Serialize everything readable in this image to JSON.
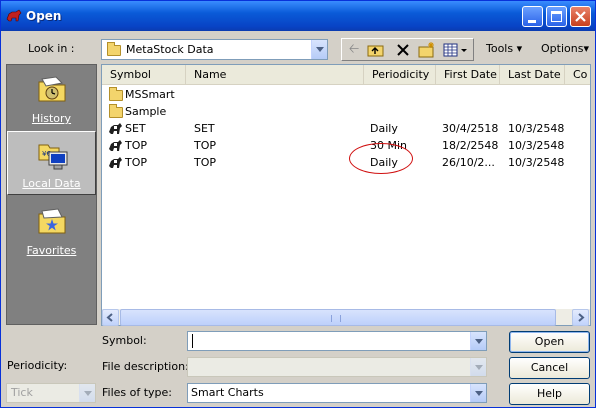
{
  "window": {
    "title": "Open"
  },
  "look_in": {
    "label": "Look in :",
    "value": "MetaStock Data"
  },
  "toolbar": {
    "tools_label": "Tools",
    "options_label": "Options"
  },
  "places": [
    {
      "label": "History"
    },
    {
      "label": "Local Data"
    },
    {
      "label": "Favorites"
    }
  ],
  "columns": [
    "Symbol",
    "Name",
    "Periodicity",
    "First Date",
    "Last Date",
    "Co"
  ],
  "rows": [
    {
      "symbol": "MSSmart",
      "type": "folder",
      "name": "",
      "periodicity": "",
      "first_date": "",
      "last_date": ""
    },
    {
      "symbol": "Sample",
      "type": "folder",
      "name": "",
      "periodicity": "",
      "first_date": "",
      "last_date": ""
    },
    {
      "symbol": "SET",
      "type": "chart",
      "name": "SET",
      "periodicity": "Daily",
      "first_date": "30/4/2518",
      "last_date": "10/3/2548"
    },
    {
      "symbol": "TOP",
      "type": "chart",
      "name": "TOP",
      "periodicity": "30 Min",
      "first_date": "18/2/2548",
      "last_date": "10/3/2548"
    },
    {
      "symbol": "TOP",
      "type": "chart",
      "name": "TOP",
      "periodicity": "Daily",
      "first_date": "26/10/2...",
      "last_date": "10/3/2548"
    }
  ],
  "form": {
    "symbol_label": "Symbol:",
    "symbol_value": "",
    "description_label": "File description:",
    "files_of_type_label": "Files of type:",
    "files_of_type_value": "Smart Charts",
    "periodicity_label": "Periodicity:",
    "periodicity_value": "Tick"
  },
  "buttons": {
    "open": "Open",
    "cancel": "Cancel",
    "help": "Help"
  },
  "colors": {
    "titlebar": "#0a5bd8",
    "annotation": "#d01010"
  }
}
